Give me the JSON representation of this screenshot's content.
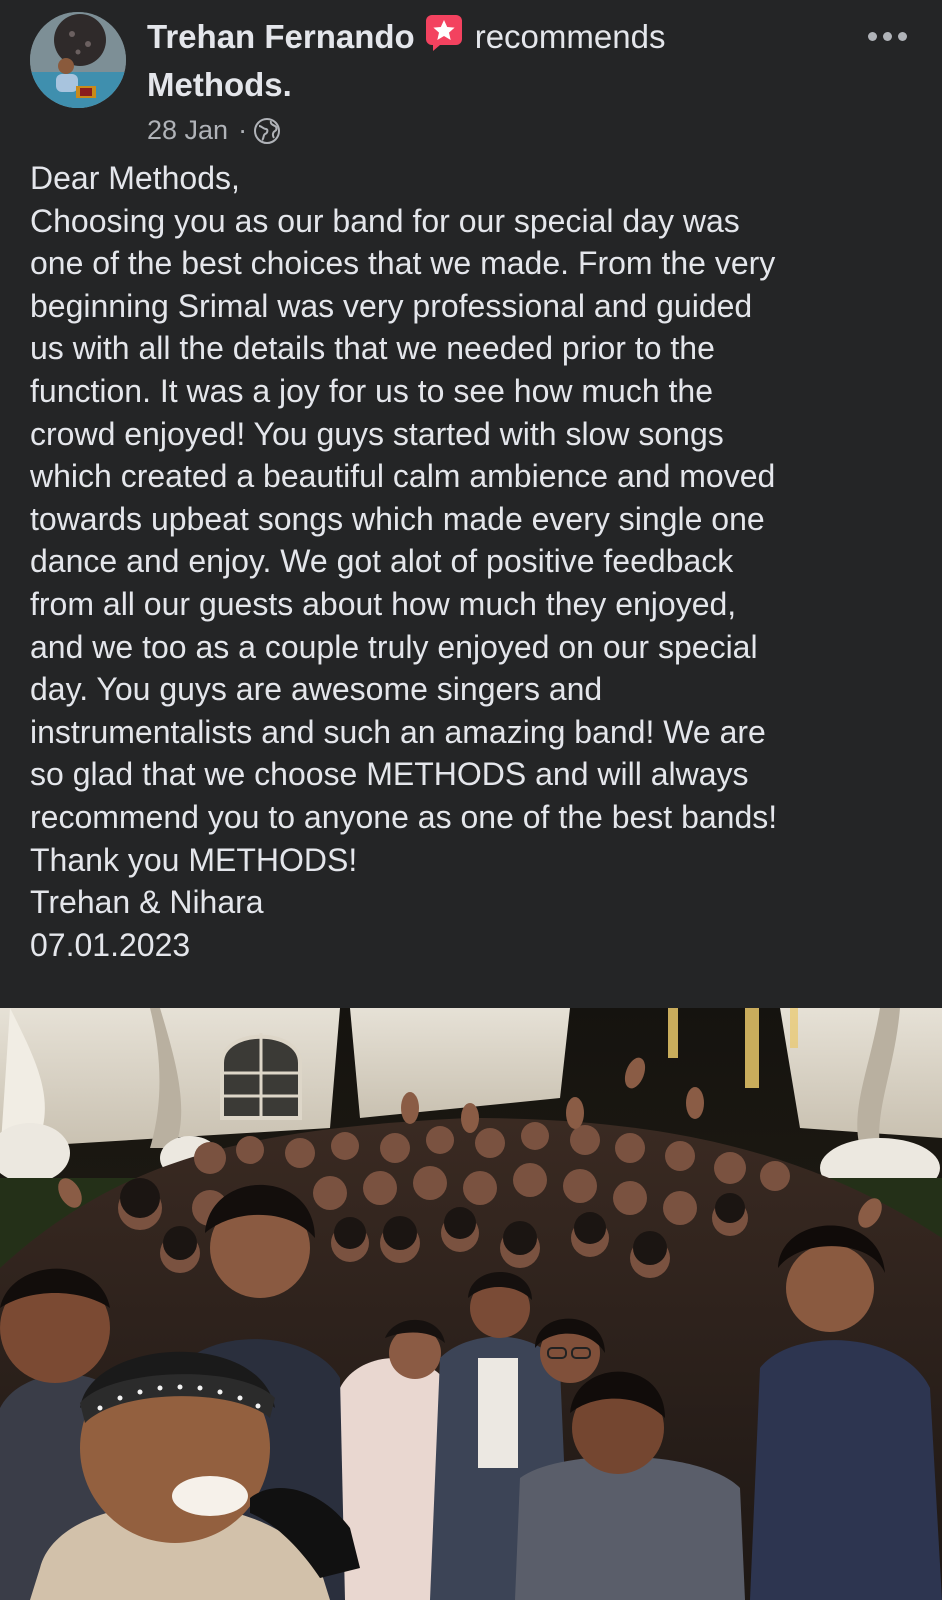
{
  "post": {
    "author": "Trehan Fernando",
    "action": "recommends",
    "page": "Methods.",
    "date": "28 Jan",
    "separator": "·",
    "audience_icon": "globe-icon",
    "recommend_icon": "recommend-star-icon",
    "more_icon": "more-options-icon",
    "text_lines": [
      "Dear Methods,",
      "Choosing you as our band for our special day was",
      "one of the best choices that we made. From the very",
      "beginning Srimal was very professional and guided",
      "us with all the details that we needed prior to the",
      "function. It was a joy for us to see how much the",
      "crowd enjoyed! You guys started with slow songs",
      "which created a beautiful calm ambience and moved",
      "towards upbeat songs which made every single one",
      "dance and enjoy. We got alot of positive feedback",
      "from all our guests about how much they enjoyed,",
      "and we too as a couple truly enjoyed on our special",
      "day. You guys are awesome singers and",
      "instrumentalists and such an amazing band! We are",
      "so glad that we choose METHODS and will always",
      "recommend you to anyone as one of the best bands!",
      "Thank you METHODS!",
      "Trehan & Nihara",
      "07.01.2023"
    ]
  },
  "colors": {
    "background": "#242526",
    "primary_text": "#e4e6eb",
    "secondary_text": "#b0b3b8",
    "recommend_badge": "#f3425f"
  }
}
